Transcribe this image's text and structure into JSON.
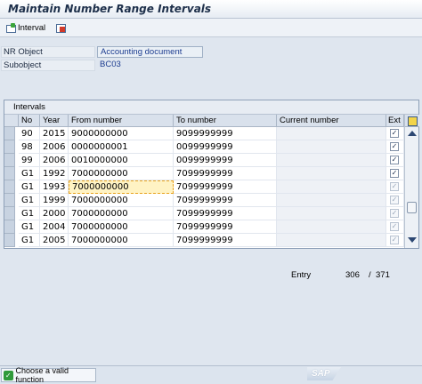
{
  "title": "Maintain Number Range Intervals",
  "toolbar": {
    "interval_label": "Interval",
    "interval_icon": "interval-icon",
    "delete_icon": "delete-interval-icon"
  },
  "header": {
    "nr_object_label": "NR Object",
    "nr_object_value": "Accounting document",
    "subobject_label": "Subobject",
    "subobject_value": "BC03"
  },
  "intervals": {
    "title": "Intervals",
    "columns": [
      "No",
      "Year",
      "From number",
      "To number",
      "Current number",
      "Ext"
    ],
    "rows": [
      {
        "no": "90",
        "year": "2015",
        "from": "9000000000",
        "to": "9099999999",
        "current": "",
        "ext": true
      },
      {
        "no": "98",
        "year": "2006",
        "from": "0000000001",
        "to": "0099999999",
        "current": "",
        "ext": true
      },
      {
        "no": "99",
        "year": "2006",
        "from": "0010000000",
        "to": "0099999999",
        "current": "",
        "ext": true
      },
      {
        "no": "G1",
        "year": "1992",
        "from": "7000000000",
        "to": "7099999999",
        "current": "",
        "ext": true
      },
      {
        "no": "G1",
        "year": "1993",
        "from": "7000000000",
        "to": "7099999999",
        "current": "",
        "ext": true
      },
      {
        "no": "G1",
        "year": "1999",
        "from": "7000000000",
        "to": "7099999999",
        "current": "",
        "ext": true
      },
      {
        "no": "G1",
        "year": "2000",
        "from": "7000000000",
        "to": "7099999999",
        "current": "",
        "ext": true
      },
      {
        "no": "G1",
        "year": "2004",
        "from": "7000000000",
        "to": "7099999999",
        "current": "",
        "ext": true
      },
      {
        "no": "G1",
        "year": "2005",
        "from": "7000000000",
        "to": "7099999999",
        "current": "",
        "ext": true
      }
    ],
    "selected_row_index": 4
  },
  "entry": {
    "label": "Entry",
    "current": "306",
    "separator": "/",
    "total": "371"
  },
  "status": {
    "message": "Choose a valid function",
    "logo": "SAP"
  },
  "colors": {
    "title_text": "#1d2f4a",
    "link_value": "#1b3b8f",
    "selection_border": "#e8a21d",
    "status_ok": "#2f9a3a"
  }
}
